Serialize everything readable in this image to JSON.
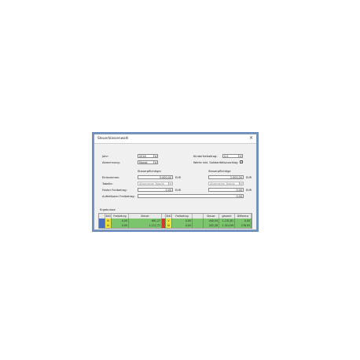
{
  "window": {
    "title": "Steuerklassenwahl",
    "close_glyph": "×"
  },
  "form": {
    "jahr_label": "Jahr:",
    "jahr_value": "2018",
    "abrechnung_label": "Abrechnung:",
    "abrechnung_value": "Monat",
    "kinder_label": "Kinderfreibetrag:",
    "kinder_value": "0,0",
    "soli_label": "Werte inkl. Solidaritätszuschlag",
    "soli_checked": "✓",
    "col1_header": "Steuerpflichtiger",
    "col2_header": "Steuerpflichtige",
    "einkommen_label": "Einkommen:",
    "einkommen_1": "5.000,00",
    "einkommen_2": "2.000,00",
    "tabelle_label": "Tabelle:",
    "tabelle_1": "Allgemeine Tabelle",
    "tabelle_2": "Allgemeine Tabelle",
    "fester_label": "Fester Freibetrag:",
    "fester_1": "0,00",
    "fester_2": "0,00",
    "aufteilbar_label": "Aufteilbarer Freibetrag:",
    "aufteilbar_value": "0,00",
    "unit": "EUR"
  },
  "results": {
    "label": "Ergebnisse",
    "headers": [
      "",
      "StKl",
      "Freibetrag",
      "Steuer",
      "",
      "StKl",
      "Freibetrag",
      "",
      "Steuer",
      "gesamt",
      "Differenz"
    ],
    "rows": [
      [
        "",
        "III",
        "0,00",
        "691,27",
        "",
        "V",
        "0,00",
        "",
        "440,54",
        "1.131,81",
        "0,00"
      ],
      [
        "",
        "IV",
        "0,00",
        "1.112,71",
        "",
        "IV",
        "0,00",
        "",
        "202,28",
        "1.314,99",
        "176,93"
      ]
    ]
  }
}
